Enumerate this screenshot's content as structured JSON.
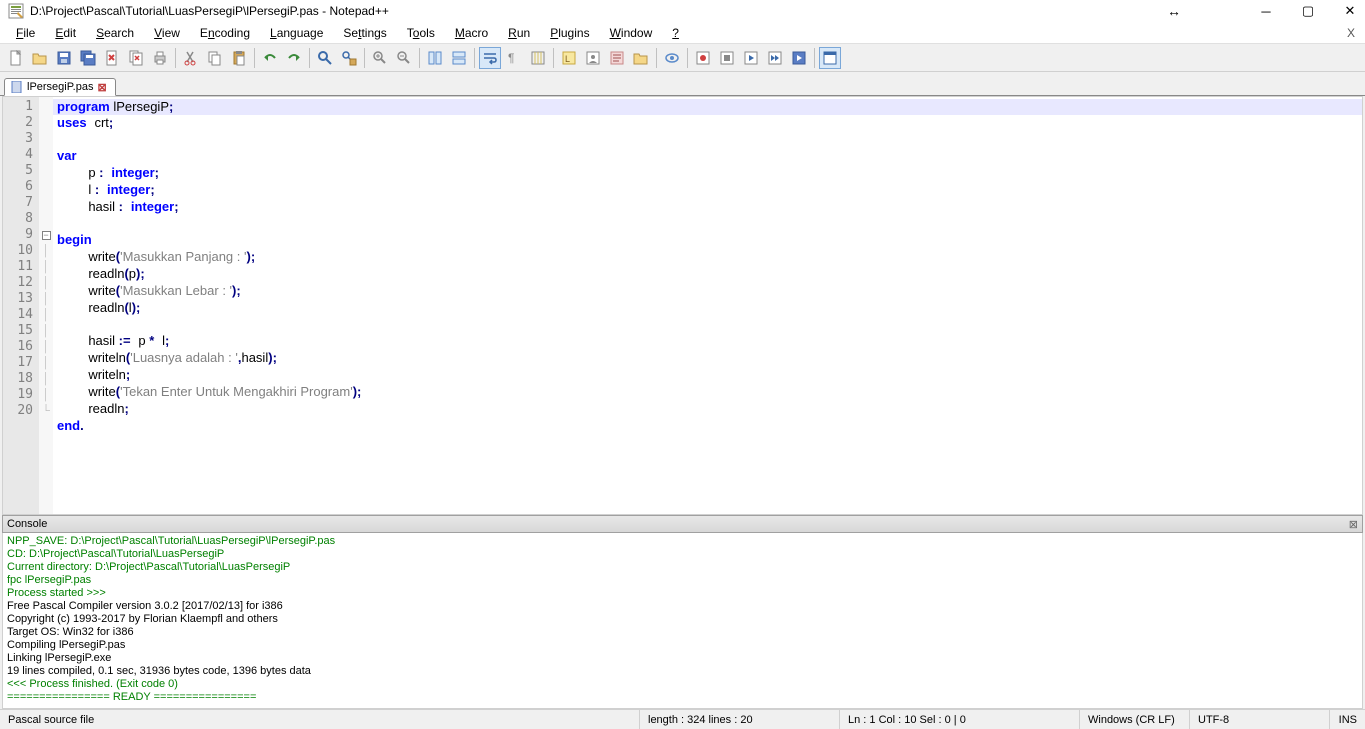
{
  "window": {
    "title": "D:\\Project\\Pascal\\Tutorial\\LuasPersegiP\\lPersegiP.pas - Notepad++"
  },
  "menu": {
    "items": [
      "File",
      "Edit",
      "Search",
      "View",
      "Encoding",
      "Language",
      "Settings",
      "Tools",
      "Macro",
      "Run",
      "Plugins",
      "Window",
      "?"
    ]
  },
  "tab": {
    "label": "lPersegiP.pas"
  },
  "code": {
    "lines": [
      {
        "n": 1,
        "fold": "",
        "tokens": [
          {
            "t": "kw",
            "v": "program"
          },
          {
            "t": "sp",
            "v": " l"
          },
          {
            "t": "id",
            "v": "PersegiP"
          },
          {
            "t": "op",
            "v": ";"
          }
        ],
        "current": true
      },
      {
        "n": 2,
        "fold": "",
        "tokens": [
          {
            "t": "kw",
            "v": "uses"
          },
          {
            "t": "sp",
            "v": " "
          },
          {
            "t": "id",
            "v": "crt"
          },
          {
            "t": "op",
            "v": ";"
          }
        ]
      },
      {
        "n": 3,
        "fold": "",
        "tokens": []
      },
      {
        "n": 4,
        "fold": "",
        "tokens": [
          {
            "t": "kw",
            "v": "var"
          }
        ]
      },
      {
        "n": 5,
        "fold": "",
        "tokens": [
          {
            "t": "sp",
            "v": "    "
          },
          {
            "t": "id",
            "v": "p "
          },
          {
            "t": "op",
            "v": ":"
          },
          {
            "t": "sp",
            "v": " "
          },
          {
            "t": "kw",
            "v": "integer"
          },
          {
            "t": "op",
            "v": ";"
          }
        ]
      },
      {
        "n": 6,
        "fold": "",
        "tokens": [
          {
            "t": "sp",
            "v": "    "
          },
          {
            "t": "id",
            "v": "l "
          },
          {
            "t": "op",
            "v": ":"
          },
          {
            "t": "sp",
            "v": " "
          },
          {
            "t": "kw",
            "v": "integer"
          },
          {
            "t": "op",
            "v": ";"
          }
        ]
      },
      {
        "n": 7,
        "fold": "",
        "tokens": [
          {
            "t": "sp",
            "v": "    "
          },
          {
            "t": "id",
            "v": "hasil "
          },
          {
            "t": "op",
            "v": ":"
          },
          {
            "t": "sp",
            "v": " "
          },
          {
            "t": "kw",
            "v": "integer"
          },
          {
            "t": "op",
            "v": ";"
          }
        ]
      },
      {
        "n": 8,
        "fold": "",
        "tokens": []
      },
      {
        "n": 9,
        "fold": "minus",
        "tokens": [
          {
            "t": "kw",
            "v": "begin"
          }
        ]
      },
      {
        "n": 10,
        "fold": "bar",
        "tokens": [
          {
            "t": "sp",
            "v": "    "
          },
          {
            "t": "id",
            "v": "write"
          },
          {
            "t": "op",
            "v": "("
          },
          {
            "t": "str",
            "v": "'Masukkan Panjang : '"
          },
          {
            "t": "op",
            "v": ")"
          },
          {
            "t": "op",
            "v": ";"
          }
        ]
      },
      {
        "n": 11,
        "fold": "bar",
        "tokens": [
          {
            "t": "sp",
            "v": "    "
          },
          {
            "t": "id",
            "v": "readln"
          },
          {
            "t": "op",
            "v": "("
          },
          {
            "t": "id",
            "v": "p"
          },
          {
            "t": "op",
            "v": ")"
          },
          {
            "t": "op",
            "v": ";"
          }
        ]
      },
      {
        "n": 12,
        "fold": "bar",
        "tokens": [
          {
            "t": "sp",
            "v": "    "
          },
          {
            "t": "id",
            "v": "write"
          },
          {
            "t": "op",
            "v": "("
          },
          {
            "t": "str",
            "v": "'Masukkan Lebar : '"
          },
          {
            "t": "op",
            "v": ")"
          },
          {
            "t": "op",
            "v": ";"
          }
        ]
      },
      {
        "n": 13,
        "fold": "bar",
        "tokens": [
          {
            "t": "sp",
            "v": "    "
          },
          {
            "t": "id",
            "v": "readln"
          },
          {
            "t": "op",
            "v": "("
          },
          {
            "t": "id",
            "v": "l"
          },
          {
            "t": "op",
            "v": ")"
          },
          {
            "t": "op",
            "v": ";"
          }
        ]
      },
      {
        "n": 14,
        "fold": "bar",
        "tokens": []
      },
      {
        "n": 15,
        "fold": "bar",
        "tokens": [
          {
            "t": "sp",
            "v": "    "
          },
          {
            "t": "id",
            "v": "hasil "
          },
          {
            "t": "op",
            "v": ":="
          },
          {
            "t": "sp",
            "v": " "
          },
          {
            "t": "id",
            "v": "p "
          },
          {
            "t": "op",
            "v": "*"
          },
          {
            "t": "sp",
            "v": " "
          },
          {
            "t": "id",
            "v": "l"
          },
          {
            "t": "op",
            "v": ";"
          }
        ]
      },
      {
        "n": 16,
        "fold": "bar",
        "tokens": [
          {
            "t": "sp",
            "v": "    "
          },
          {
            "t": "id",
            "v": "writeln"
          },
          {
            "t": "op",
            "v": "("
          },
          {
            "t": "str",
            "v": "'Luasnya adalah : '"
          },
          {
            "t": "op",
            "v": ","
          },
          {
            "t": "id",
            "v": "hasil"
          },
          {
            "t": "op",
            "v": ")"
          },
          {
            "t": "op",
            "v": ";"
          }
        ]
      },
      {
        "n": 17,
        "fold": "bar",
        "tokens": [
          {
            "t": "sp",
            "v": "    "
          },
          {
            "t": "id",
            "v": "writeln"
          },
          {
            "t": "op",
            "v": ";"
          }
        ]
      },
      {
        "n": 18,
        "fold": "bar",
        "tokens": [
          {
            "t": "sp",
            "v": "    "
          },
          {
            "t": "id",
            "v": "write"
          },
          {
            "t": "op",
            "v": "("
          },
          {
            "t": "str",
            "v": "'Tekan Enter Untuk Mengakhiri Program'"
          },
          {
            "t": "op",
            "v": ")"
          },
          {
            "t": "op",
            "v": ";"
          }
        ]
      },
      {
        "n": 19,
        "fold": "bar",
        "tokens": [
          {
            "t": "sp",
            "v": "    "
          },
          {
            "t": "id",
            "v": "readln"
          },
          {
            "t": "op",
            "v": ";"
          }
        ]
      },
      {
        "n": 20,
        "fold": "end",
        "tokens": [
          {
            "t": "kw",
            "v": "end"
          },
          {
            "t": "op",
            "v": "."
          }
        ]
      }
    ]
  },
  "console": {
    "title": "Console",
    "lines": [
      {
        "c": "g",
        "t": "NPP_SAVE: D:\\Project\\Pascal\\Tutorial\\LuasPersegiP\\lPersegiP.pas"
      },
      {
        "c": "g",
        "t": "CD: D:\\Project\\Pascal\\Tutorial\\LuasPersegiP"
      },
      {
        "c": "g",
        "t": "Current directory: D:\\Project\\Pascal\\Tutorial\\LuasPersegiP"
      },
      {
        "c": "g",
        "t": "fpc lPersegiP.pas"
      },
      {
        "c": "g",
        "t": "Process started >>>"
      },
      {
        "c": "b",
        "t": "Free Pascal Compiler version 3.0.2 [2017/02/13] for i386"
      },
      {
        "c": "b",
        "t": "Copyright (c) 1993-2017 by Florian Klaempfl and others"
      },
      {
        "c": "b",
        "t": "Target OS: Win32 for i386"
      },
      {
        "c": "b",
        "t": "Compiling lPersegiP.pas"
      },
      {
        "c": "b",
        "t": "Linking lPersegiP.exe"
      },
      {
        "c": "b",
        "t": "19 lines compiled, 0.1 sec, 31936 bytes code, 1396 bytes data"
      },
      {
        "c": "g",
        "t": "<<< Process finished. (Exit code 0)"
      },
      {
        "c": "g",
        "t": "================ READY ================"
      }
    ]
  },
  "status": {
    "filetype": "Pascal source file",
    "length": "length : 324    lines : 20",
    "pos": "Ln : 1    Col : 10    Sel : 0 | 0",
    "eol": "Windows (CR LF)",
    "enc": "UTF-8",
    "ins": "INS"
  }
}
